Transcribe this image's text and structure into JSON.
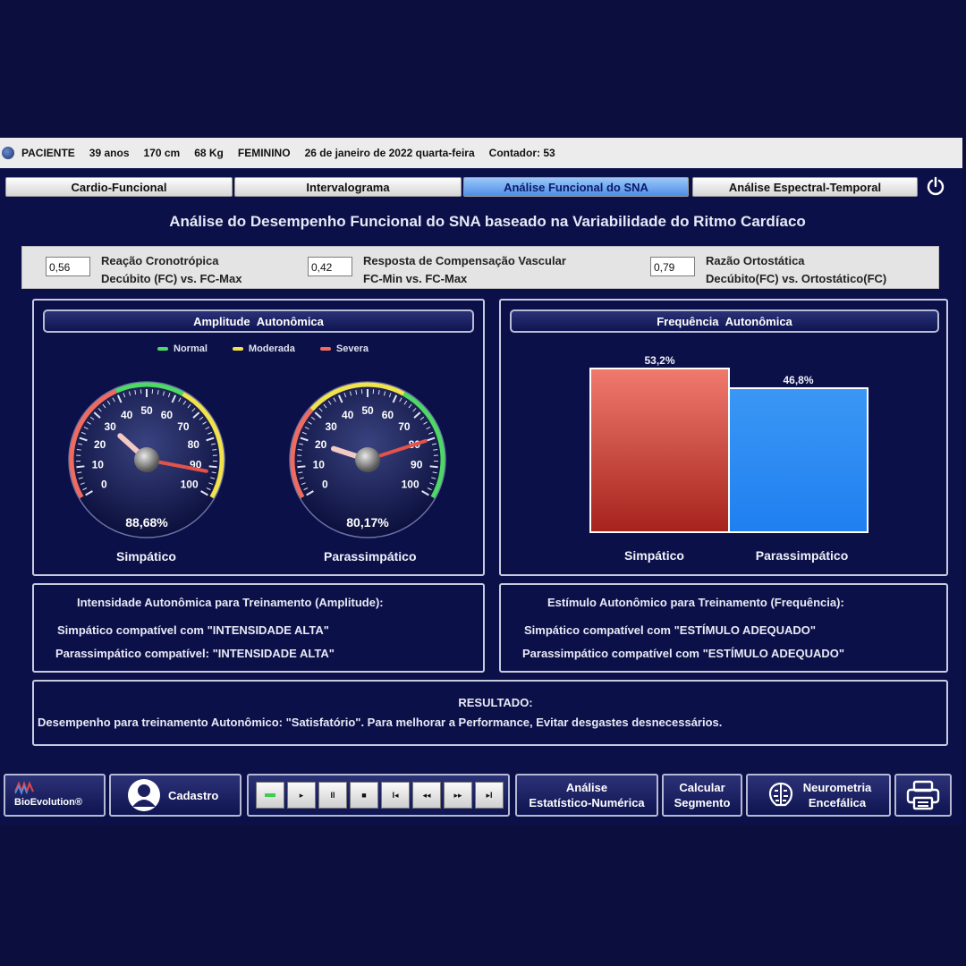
{
  "patient": {
    "label": "PACIENTE",
    "age": "39 anos",
    "height": "170 cm",
    "weight": "68 Kg",
    "sex": "FEMININO",
    "date": "26 de janeiro de 2022 quarta-feira",
    "counter": "Contador: 53"
  },
  "tabs": [
    {
      "label": "Cardio-Funcional",
      "active": false
    },
    {
      "label": "Intervalograma",
      "active": false
    },
    {
      "label": "Análise Funcional do SNA",
      "active": true
    },
    {
      "label": "Análise Espectral-Temporal",
      "active": false
    }
  ],
  "title": "Análise do Desempenho Funcional do SNA baseado na Variabilidade do Ritmo Cardíaco",
  "metrics": [
    {
      "value": "0,56",
      "line1": "Reação Cronotrópica",
      "line2": "Decúbito (FC) vs. FC-Max"
    },
    {
      "value": "0,42",
      "line1": "Resposta de Compensação Vascular",
      "line2": "FC-Min vs. FC-Max"
    },
    {
      "value": "0,79",
      "line1": "Razão Ortostática",
      "line2": "Decúbito(FC) vs. Ortostático(FC)"
    }
  ],
  "amplitude": {
    "header": "Amplitude Autonômica",
    "legend": [
      {
        "label": "Normal",
        "color": "#4cd964"
      },
      {
        "label": "Moderada",
        "color": "#f2e34a"
      },
      {
        "label": "Severa",
        "color": "#f06b5e"
      }
    ],
    "ticks": [
      "0",
      "10",
      "20",
      "30",
      "40",
      "50",
      "60",
      "70",
      "80",
      "90",
      "100"
    ],
    "gauges": [
      {
        "name": "Simpático",
        "value": 88.68,
        "readout": "88,68%",
        "red_needle": 92,
        "white_needle": 30,
        "arc": "green-top"
      },
      {
        "name": "Parassimpático",
        "value": 80.17,
        "readout": "80,17%",
        "red_needle": 80,
        "white_needle": 20,
        "arc": "green-right"
      }
    ]
  },
  "frequencia": {
    "header": "Frequência Autonômica",
    "chart_data": {
      "type": "bar",
      "categories": [
        "Simpático",
        "Parassimpático"
      ],
      "values": [
        53.2,
        46.8
      ],
      "labels": [
        "53,2%",
        "46,8%"
      ],
      "colors": [
        "#e0584d",
        "#2d8cf0"
      ]
    }
  },
  "intensidade": {
    "title": "Intensidade Autonômica para Treinamento (Amplitude):",
    "line1": "Simpático compatível com \"INTENSIDADE ALTA\"",
    "line2": "Parassimpático compatível: \"INTENSIDADE ALTA\""
  },
  "estimulo": {
    "title": "Estímulo Autonômico para Treinamento (Frequência):",
    "line1": "Simpático compatível com \"ESTÍMULO ADEQUADO\"",
    "line2": "Parassimpático compatível com \"ESTÍMULO ADEQUADO\""
  },
  "resultado": {
    "title": "RESULTADO:",
    "text": "Desempenho para treinamento Autonômico: \"Satisfatório\".  Para melhorar a Performance, Evitar desgastes desnecessários."
  },
  "bottom": {
    "brand": "BioEvolution®",
    "cadastro": "Cadastro",
    "analise_1": "Análise",
    "analise_2": "Estatístico-Numérica",
    "calcular_1": "Calcular",
    "calcular_2": "Segmento",
    "neuro_1": "Neurometria",
    "neuro_2": "Encefálica",
    "player_icons": [
      "record-icon",
      "play-icon",
      "pause-icon",
      "stop-icon",
      "skip-start-icon",
      "rewind-icon",
      "fast-forward-icon",
      "skip-end-icon"
    ]
  }
}
